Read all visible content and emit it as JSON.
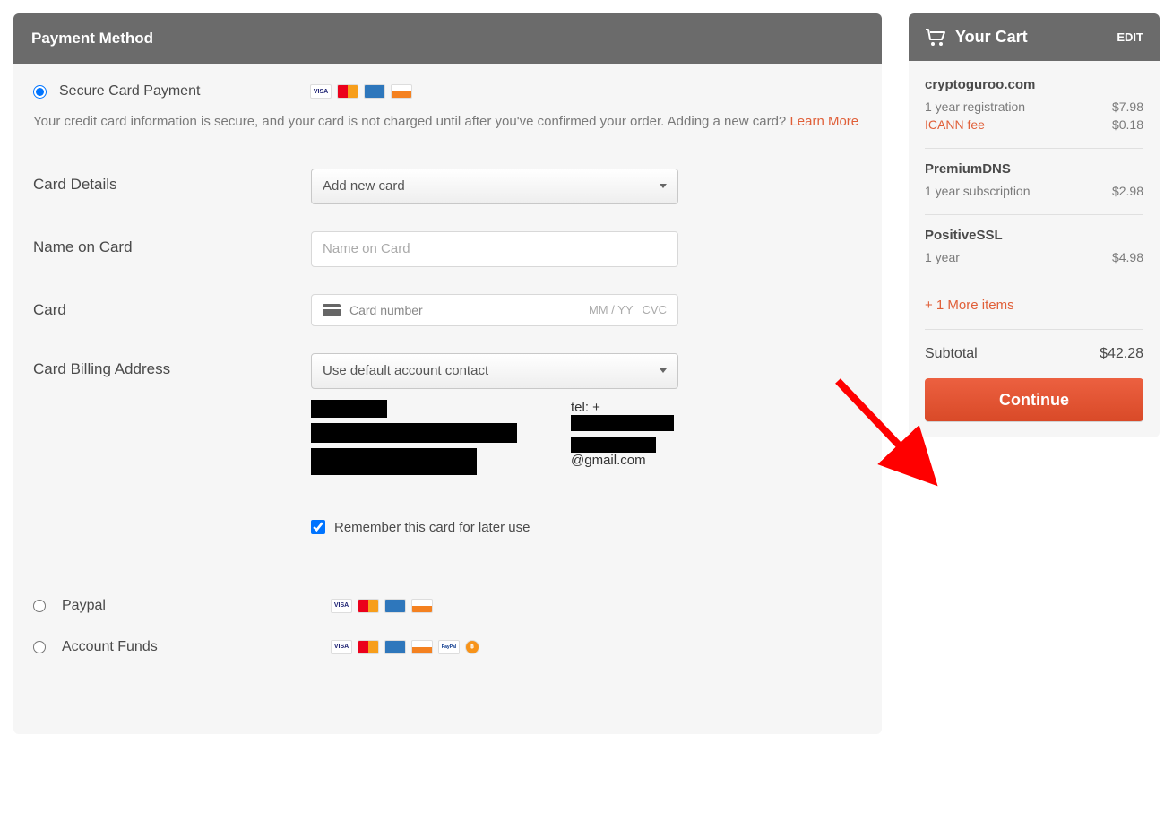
{
  "header": {
    "title": "Payment Method"
  },
  "methods": {
    "secure_card": "Secure Card Payment",
    "paypal": "Paypal",
    "account_funds": "Account Funds"
  },
  "info": {
    "text": "Your credit card information is secure, and your card is not charged until after you've confirmed your order. Adding a new card? ",
    "learn_more": "Learn More"
  },
  "labels": {
    "card_details": "Card Details",
    "name_on_card": "Name on Card",
    "card": "Card",
    "billing_address": "Card Billing Address",
    "remember": "Remember this card for later use"
  },
  "selects": {
    "card_details_value": "Add new card",
    "billing_value": "Use default account contact"
  },
  "placeholders": {
    "name_on_card": "Name on Card",
    "card_number": "Card number",
    "mmyy": "MM / YY",
    "cvc": "CVC"
  },
  "billing_contact": {
    "tel_prefix": "tel: +",
    "email_suffix": "@gmail.com"
  },
  "remember_checked": true,
  "cart": {
    "title": "Your Cart",
    "edit": "EDIT",
    "items": [
      {
        "name": "cryptoguroo.com",
        "lines": [
          {
            "label": "1 year registration",
            "price": "$7.98",
            "fee": false
          },
          {
            "label": "ICANN fee",
            "price": "$0.18",
            "fee": true
          }
        ]
      },
      {
        "name": "PremiumDNS",
        "lines": [
          {
            "label": "1 year subscription",
            "price": "$2.98",
            "fee": false
          }
        ]
      },
      {
        "name": "PositiveSSL",
        "lines": [
          {
            "label": "1 year",
            "price": "$4.98",
            "fee": false
          }
        ]
      }
    ],
    "more_items": "+ 1 More items",
    "subtotal_label": "Subtotal",
    "subtotal_value": "$42.28",
    "continue": "Continue"
  }
}
